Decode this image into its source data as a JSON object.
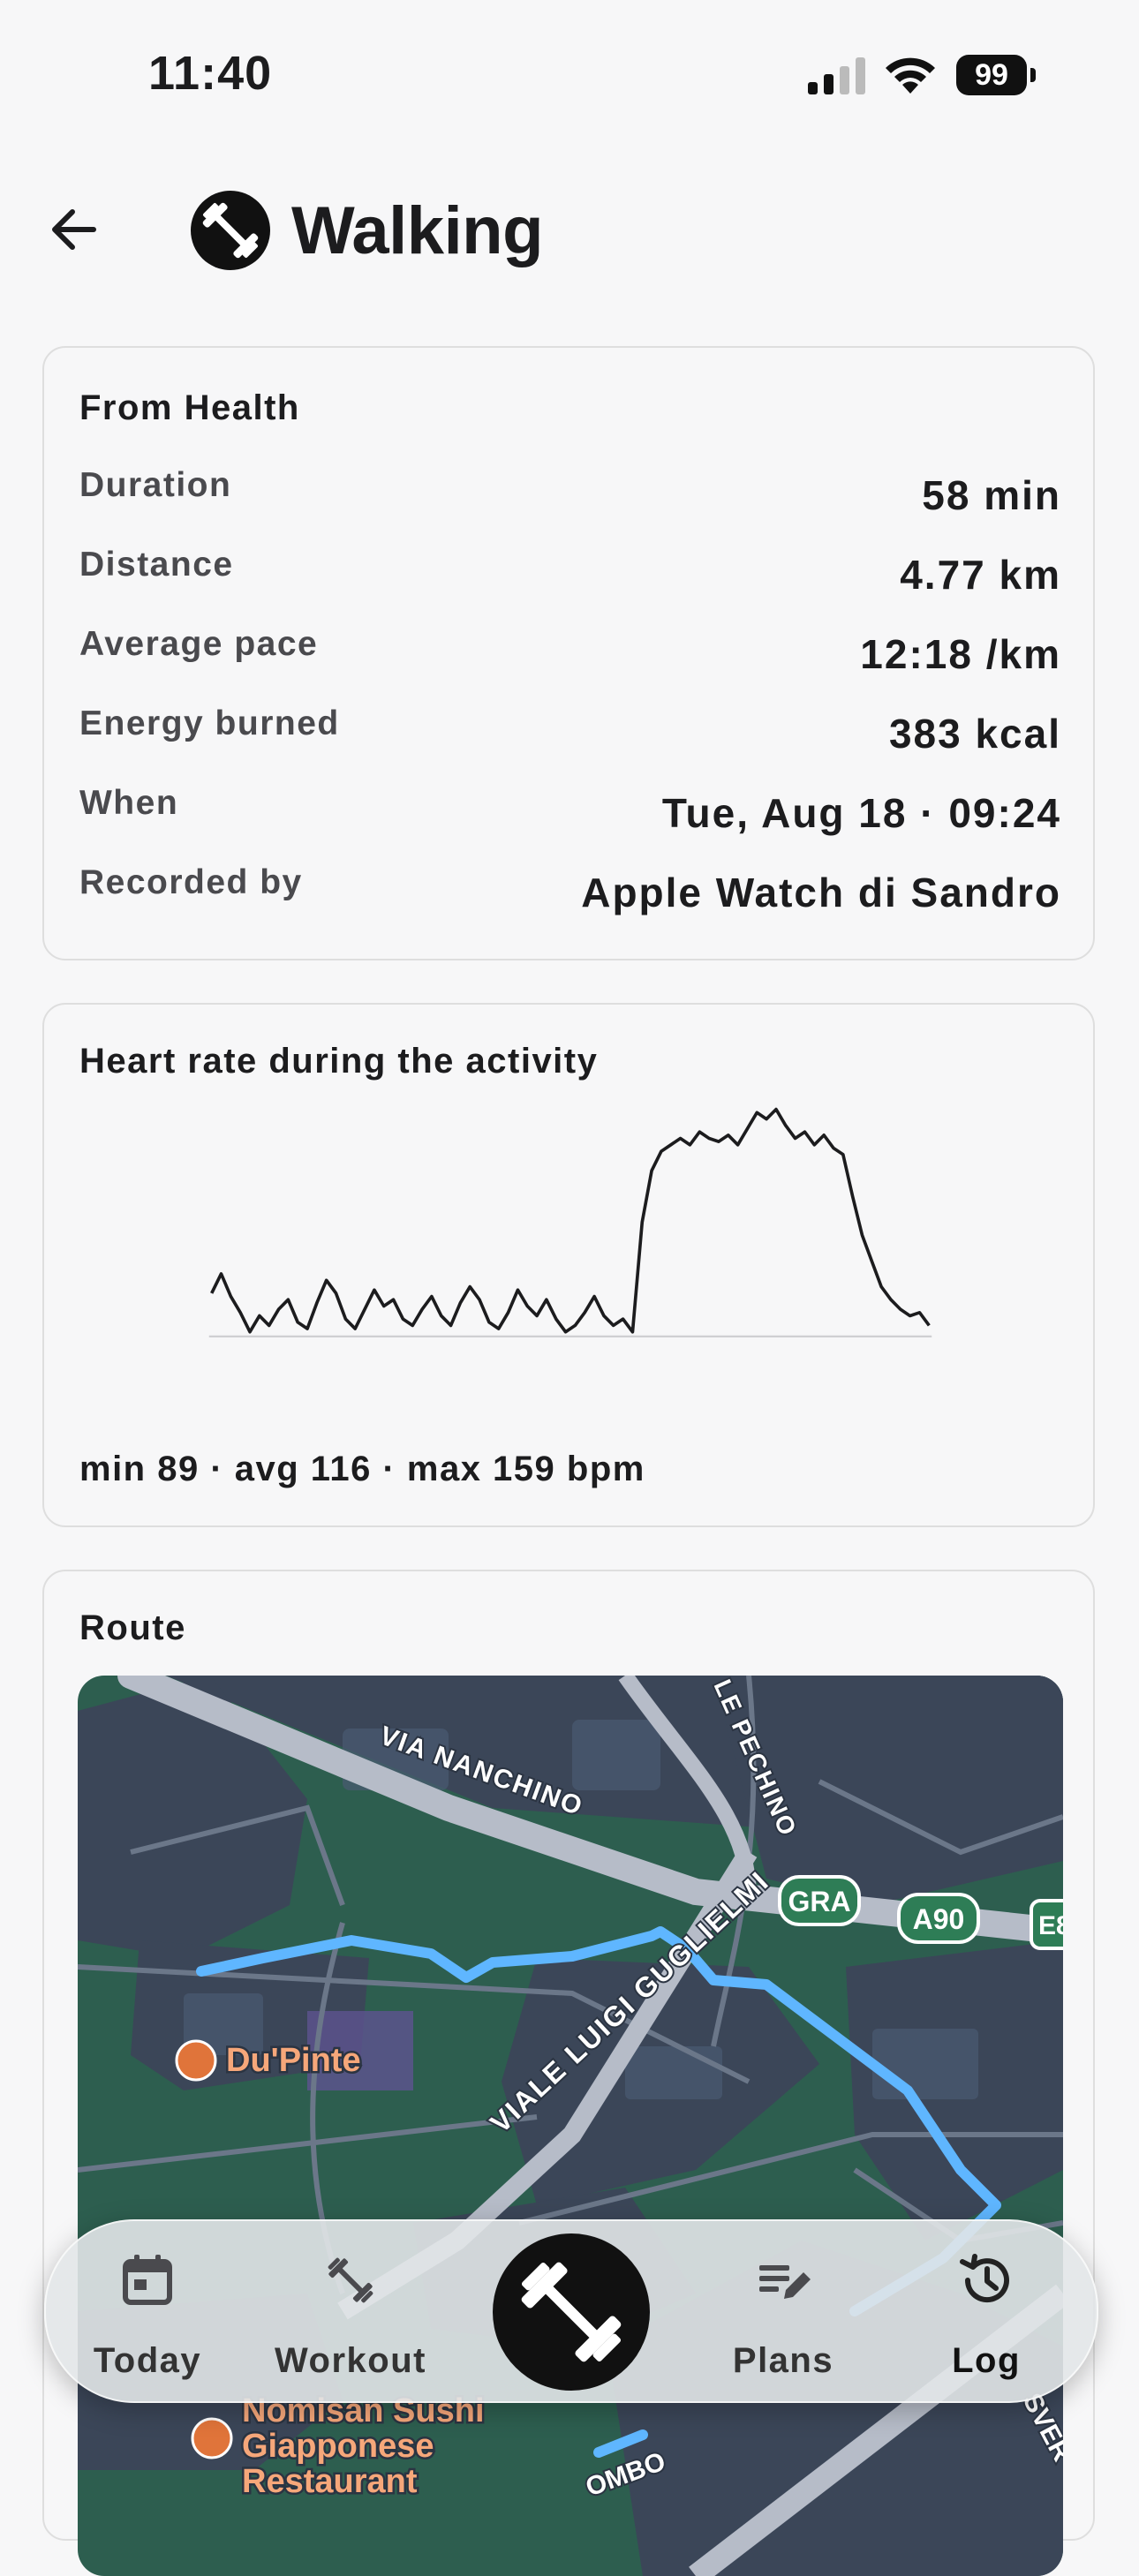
{
  "status_bar": {
    "time": "11:40",
    "battery": "99"
  },
  "header": {
    "title": "Walking"
  },
  "health": {
    "title": "From Health",
    "rows": [
      {
        "label": "Duration",
        "value": "58 min"
      },
      {
        "label": "Distance",
        "value": "4.77 km"
      },
      {
        "label": "Average pace",
        "value": "12:18 /km"
      },
      {
        "label": "Energy burned",
        "value": "383 kcal"
      },
      {
        "label": "When",
        "value": "Tue, Aug 18 · 09:24"
      },
      {
        "label": "Recorded by",
        "value": "Apple Watch di Sandro"
      }
    ]
  },
  "heart_rate": {
    "title": "Heart rate during the activity",
    "summary": "min 89 · avg 116 · max 159 bpm"
  },
  "chart_data": {
    "type": "line",
    "title": "Heart rate during the activity",
    "ylabel": "",
    "xlabel": "",
    "ylim": [
      89,
      159
    ],
    "grid": false,
    "series": [
      {
        "values": [
          102,
          108,
          101,
          96,
          90,
          95,
          92,
          97,
          100,
          93,
          91,
          99,
          106,
          102,
          94,
          91,
          97,
          103,
          98,
          100,
          94,
          92,
          97,
          101,
          95,
          92,
          99,
          104,
          100,
          93,
          91,
          96,
          103,
          98,
          95,
          100,
          94,
          90,
          92,
          96,
          101,
          95,
          92,
          94,
          90,
          124,
          140,
          146,
          148,
          150,
          148,
          152,
          150,
          149,
          151,
          148,
          153,
          158,
          156,
          159,
          154,
          150,
          152,
          148,
          151,
          147,
          145,
          132,
          120,
          112,
          104,
          100,
          97,
          95,
          96,
          92
        ]
      }
    ]
  },
  "route": {
    "title": "Route",
    "labels": {
      "via_nanchino": "VIA NANCHINO",
      "pechino": "LE PECHINO",
      "viale_luigi": "VIALE LUIGI GUGLIELMI",
      "gra": "GRA",
      "a90": "A90",
      "e_badge": "E8",
      "du_pinte": "Du'Pinte",
      "nomisan_1": "Nomisan Sushi",
      "nomisan_2": "Giapponese",
      "nomisan_3": "Restaurant",
      "ombo": "OMBO",
      "sver": "SVER"
    }
  },
  "tabs": [
    {
      "label": "Today",
      "icon": "calendar-icon"
    },
    {
      "label": "Workout",
      "icon": "dumbbell-icon"
    },
    {
      "label": "Plans",
      "icon": "edit-list-icon"
    },
    {
      "label": "Log",
      "icon": "history-icon"
    }
  ],
  "colors": {
    "accent": "#111111",
    "route": "#5fb6ff",
    "map_green": "#2d5e4f",
    "map_block": "#3a4a5c"
  }
}
